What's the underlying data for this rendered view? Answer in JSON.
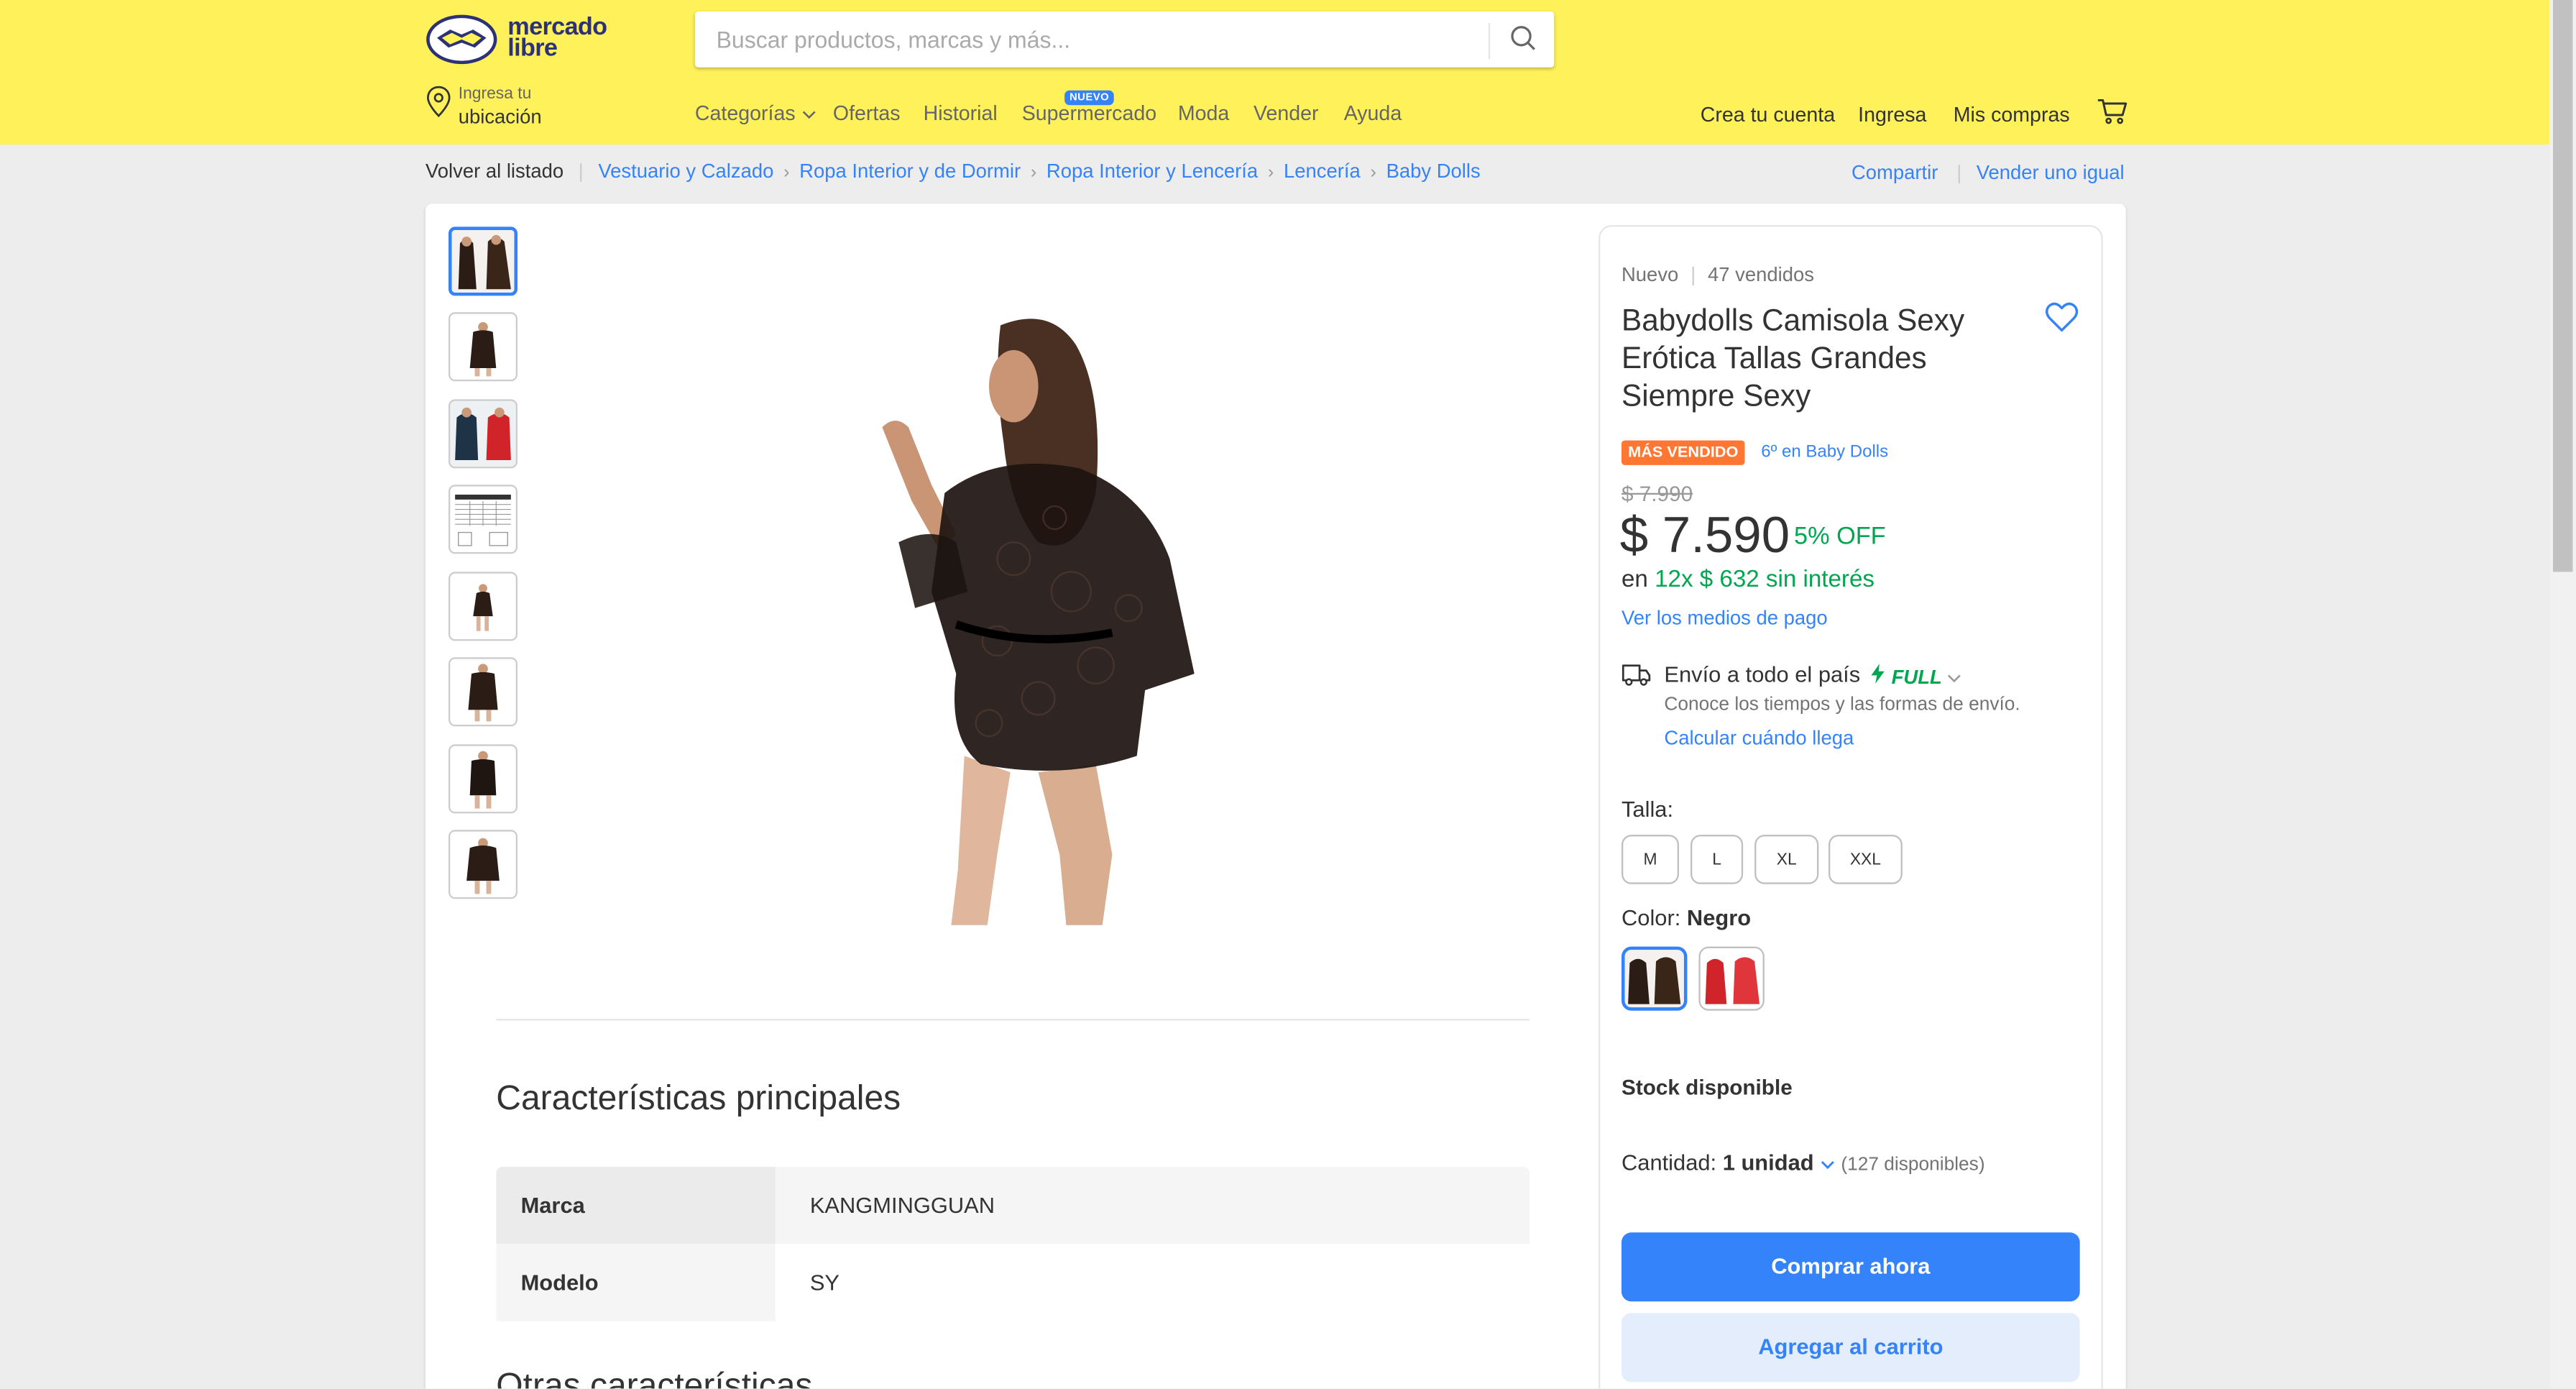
{
  "header": {
    "logo_line1": "mercado",
    "logo_line2": "libre",
    "search_placeholder": "Buscar productos, marcas y más...",
    "location_small": "Ingresa tu",
    "location_big": "ubicación",
    "nav": [
      "Categorías",
      "Ofertas",
      "Historial",
      "Supermercado",
      "Moda",
      "Vender",
      "Ayuda"
    ],
    "nuevo_badge": "NUEVO",
    "create_account": "Crea tu cuenta",
    "login": "Ingresa",
    "purchases": "Mis compras",
    "brand_color": "#fff159"
  },
  "breadcrumb": {
    "back": "Volver al listado",
    "items": [
      "Vestuario y Calzado",
      "Ropa Interior y de Dormir",
      "Ropa Interior y Lencería",
      "Lencería",
      "Baby Dolls"
    ],
    "share": "Compartir",
    "sell_same": "Vender uno igual"
  },
  "gallery": {
    "thumbnails": [
      "black-robe-front-back",
      "black-robe-front",
      "blue-and-red-robes",
      "size-chart",
      "black-robe-full",
      "black-robe-front-2",
      "black-robe-detail",
      "black-robe-back"
    ],
    "main_image": "black-lace-robe-back-view"
  },
  "product": {
    "condition": "Nuevo",
    "sold": "47 vendidos",
    "title": "Babydolls Camisola Sexy Erótica Tallas Grandes Siempre Sexy",
    "badge": "MÁS VENDIDO",
    "rank": "6º en Baby Dolls",
    "old_price": "$ 7.990",
    "price": "$ 7.590",
    "discount": "5% OFF",
    "installments_prefix": "en",
    "installments_value": "12x $ 632 sin interés",
    "payment_link": "Ver los medios de pago",
    "shipping_title": "Envío a todo el país",
    "full_label": "FULL",
    "shipping_sub": "Conoce los tiempos y las formas de envío.",
    "shipping_link": "Calcular cuándo llega",
    "size_label": "Talla:",
    "sizes": [
      "M",
      "L",
      "XL",
      "XXL"
    ],
    "color_label": "Color:",
    "color_value": "Negro",
    "colors": [
      "black",
      "red"
    ],
    "stock": "Stock disponible",
    "quantity_label": "Cantidad:",
    "quantity_value": "1 unidad",
    "quantity_available": "(127 disponibles)",
    "buy_now": "Comprar ahora",
    "add_to_cart": "Agregar al carrito",
    "accent_color": "#3483fa",
    "green_color": "#00a650"
  },
  "features": {
    "title": "Características principales",
    "rows": [
      {
        "key": "Marca",
        "value": "KANGMINGGUAN"
      },
      {
        "key": "Modelo",
        "value": "SY"
      }
    ],
    "other_title": "Otras características"
  }
}
